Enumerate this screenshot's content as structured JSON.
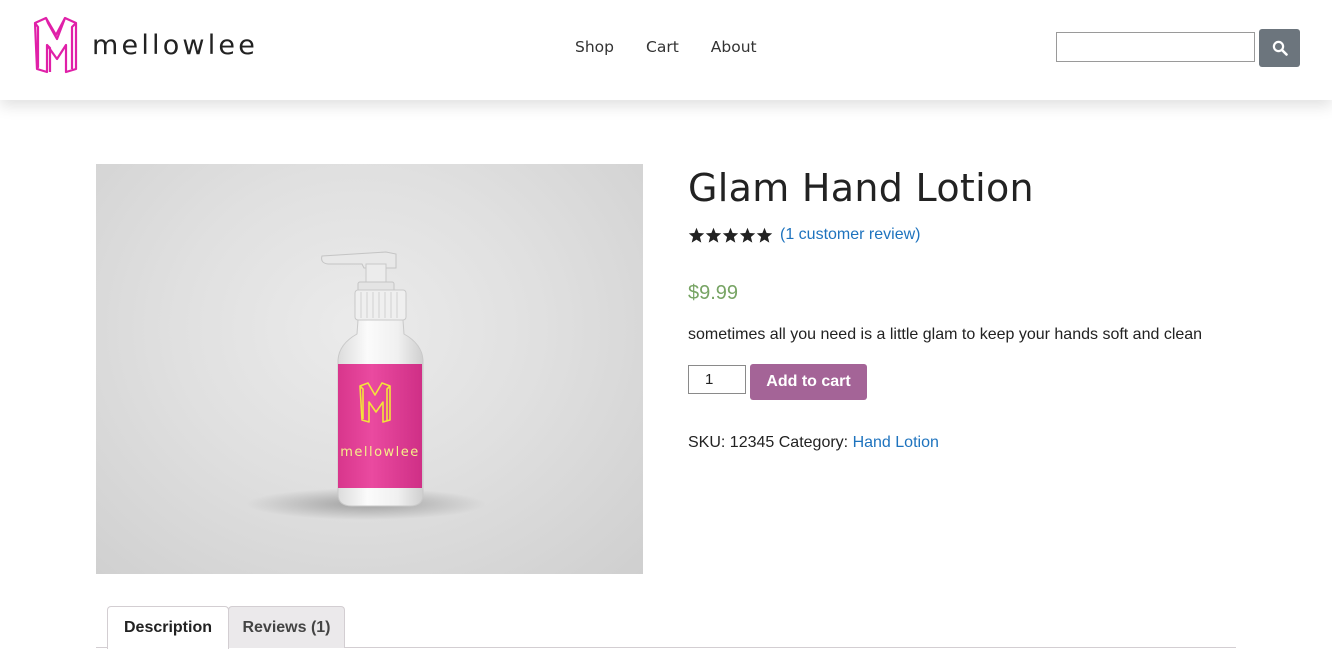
{
  "header": {
    "brand_name": "mellowlee",
    "nav": [
      {
        "label": "Shop"
      },
      {
        "label": "Cart"
      },
      {
        "label": "About"
      }
    ],
    "search": {
      "value": "",
      "placeholder": ""
    },
    "search_icon": "search-icon"
  },
  "product": {
    "title": "Glam Hand Lotion",
    "rating": 5,
    "rating_max": 5,
    "review_link": "(1 customer review)",
    "price": "$9.99",
    "short_description": "sometimes all you need is a little glam to keep your hands soft and clean",
    "quantity": "1",
    "add_to_cart_label": "Add to cart",
    "sku_label": "SKU:",
    "sku": "12345",
    "category_label": "Category:",
    "category": "Hand Lotion",
    "bottle_label_text": "mellowlee"
  },
  "tabs": [
    {
      "label": "Description"
    },
    {
      "label": "Reviews (1)"
    }
  ],
  "colors": {
    "brand_magenta": "#e020a8",
    "price_green": "#77a464",
    "button_purple": "#a46497",
    "link_blue": "#1e73be",
    "search_button": "#6c757d"
  }
}
